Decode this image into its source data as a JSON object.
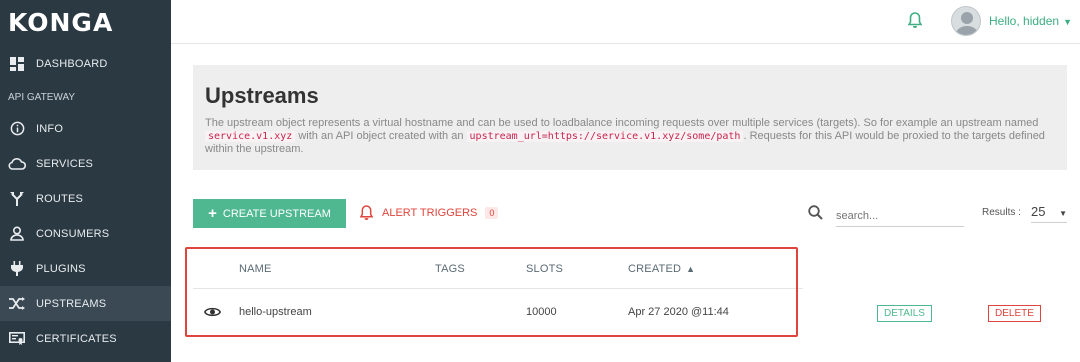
{
  "app": {
    "logo": "KONGA"
  },
  "sidebar": {
    "dashboard": "DASHBOARD",
    "section": "API GATEWAY",
    "items": [
      {
        "label": "INFO",
        "icon": "info-icon"
      },
      {
        "label": "SERVICES",
        "icon": "cloud-icon"
      },
      {
        "label": "ROUTES",
        "icon": "routes-icon"
      },
      {
        "label": "CONSUMERS",
        "icon": "user-icon"
      },
      {
        "label": "PLUGINS",
        "icon": "plug-icon"
      },
      {
        "label": "UPSTREAMS",
        "icon": "shuffle-icon",
        "active": true
      },
      {
        "label": "CERTIFICATES",
        "icon": "certificate-icon"
      }
    ]
  },
  "topbar": {
    "user": "Hello, hidden"
  },
  "page": {
    "title": "Upstreams",
    "desc_1": "The upstream object represents a virtual hostname and can be used to loadbalance incoming requests over multiple services (targets). So for example an upstream named",
    "code_1": "service.v1.xyz",
    "desc_2": "with an API object created with an",
    "code_2": "upstream_url=https://service.v1.xyz/some/path",
    "desc_3": ". Requests for this API would be proxied to the targets defined within the upstream."
  },
  "toolbar": {
    "create_label": "CREATE UPSTREAM",
    "alert_label": "ALERT TRIGGERS",
    "alert_count": "0",
    "search_placeholder": "search...",
    "results_label": "Results :",
    "results_value": "25"
  },
  "table": {
    "headers": {
      "name": "NAME",
      "tags": "TAGS",
      "slots": "SLOTS",
      "created": "CREATED"
    },
    "rows": [
      {
        "name": "hello-upstream",
        "tags": "",
        "slots": "10000",
        "created": "Apr 27 2020 @11:44"
      }
    ]
  },
  "row_actions": {
    "details": "DETAILS",
    "delete": "DELETE"
  },
  "colors": {
    "sidebar": "#2b3942",
    "accent": "#4fb890",
    "danger": "#e0443c",
    "highlight": "#e0443c"
  }
}
